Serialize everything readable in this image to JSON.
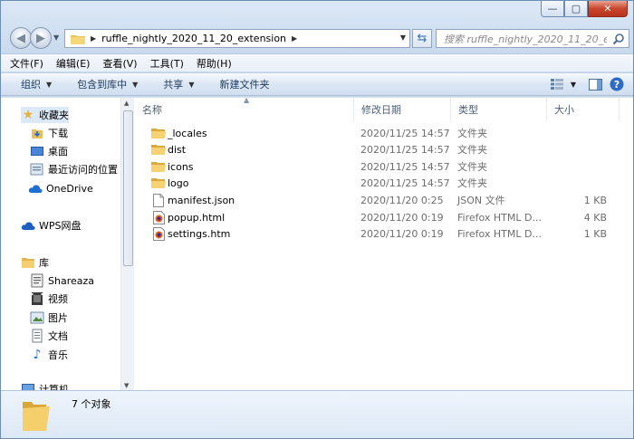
{
  "window": {
    "caption_buttons": [
      "—",
      "▢",
      "✕"
    ]
  },
  "addressbar": {
    "path_segment": "ruffle_nightly_2020_11_20_extension"
  },
  "search": {
    "placeholder": "搜索 ruffle_nightly_2020_11_20_ext..."
  },
  "menubar": {
    "items": [
      "文件(F)",
      "编辑(E)",
      "查看(V)",
      "工具(T)",
      "帮助(H)"
    ]
  },
  "toolbar": {
    "organize": "组织",
    "include_library": "包含到库中",
    "share": "共享",
    "new_folder": "新建文件夹"
  },
  "navpane": {
    "favorites": "收藏夹",
    "downloads": "下载",
    "desktop": "桌面",
    "recent": "最近访问的位置",
    "onedrive": "OneDrive",
    "wps": "WPS网盘",
    "libraries": "库",
    "shareaza": "Shareaza",
    "videos": "视频",
    "pictures": "图片",
    "documents": "文档",
    "music": "音乐",
    "computer": "计算机"
  },
  "columns": {
    "name": "名称",
    "date": "修改日期",
    "type": "类型",
    "size": "大小"
  },
  "files": [
    {
      "name": "_locales",
      "date": "2020/11/25 14:57",
      "type": "文件夹",
      "size": "",
      "icon": "folder-icon"
    },
    {
      "name": "dist",
      "date": "2020/11/25 14:57",
      "type": "文件夹",
      "size": "",
      "icon": "folder-icon"
    },
    {
      "name": "icons",
      "date": "2020/11/25 14:57",
      "type": "文件夹",
      "size": "",
      "icon": "folder-icon"
    },
    {
      "name": "logo",
      "date": "2020/11/25 14:57",
      "type": "文件夹",
      "size": "",
      "icon": "folder-icon"
    },
    {
      "name": "manifest.json",
      "date": "2020/11/20 0:25",
      "type": "JSON 文件",
      "size": "1 KB",
      "icon": "json-file-icon"
    },
    {
      "name": "popup.html",
      "date": "2020/11/20 0:19",
      "type": "Firefox HTML D...",
      "size": "4 KB",
      "icon": "firefox-html-icon"
    },
    {
      "name": "settings.htm",
      "date": "2020/11/20 0:19",
      "type": "Firefox HTML D...",
      "size": "1 KB",
      "icon": "firefox-html-icon"
    }
  ],
  "statusbar": {
    "count": "7 个对象"
  },
  "colors": {
    "accent": "#3a6fb0",
    "folder": "#f1cf6b",
    "window_frame": "#c9daee"
  }
}
